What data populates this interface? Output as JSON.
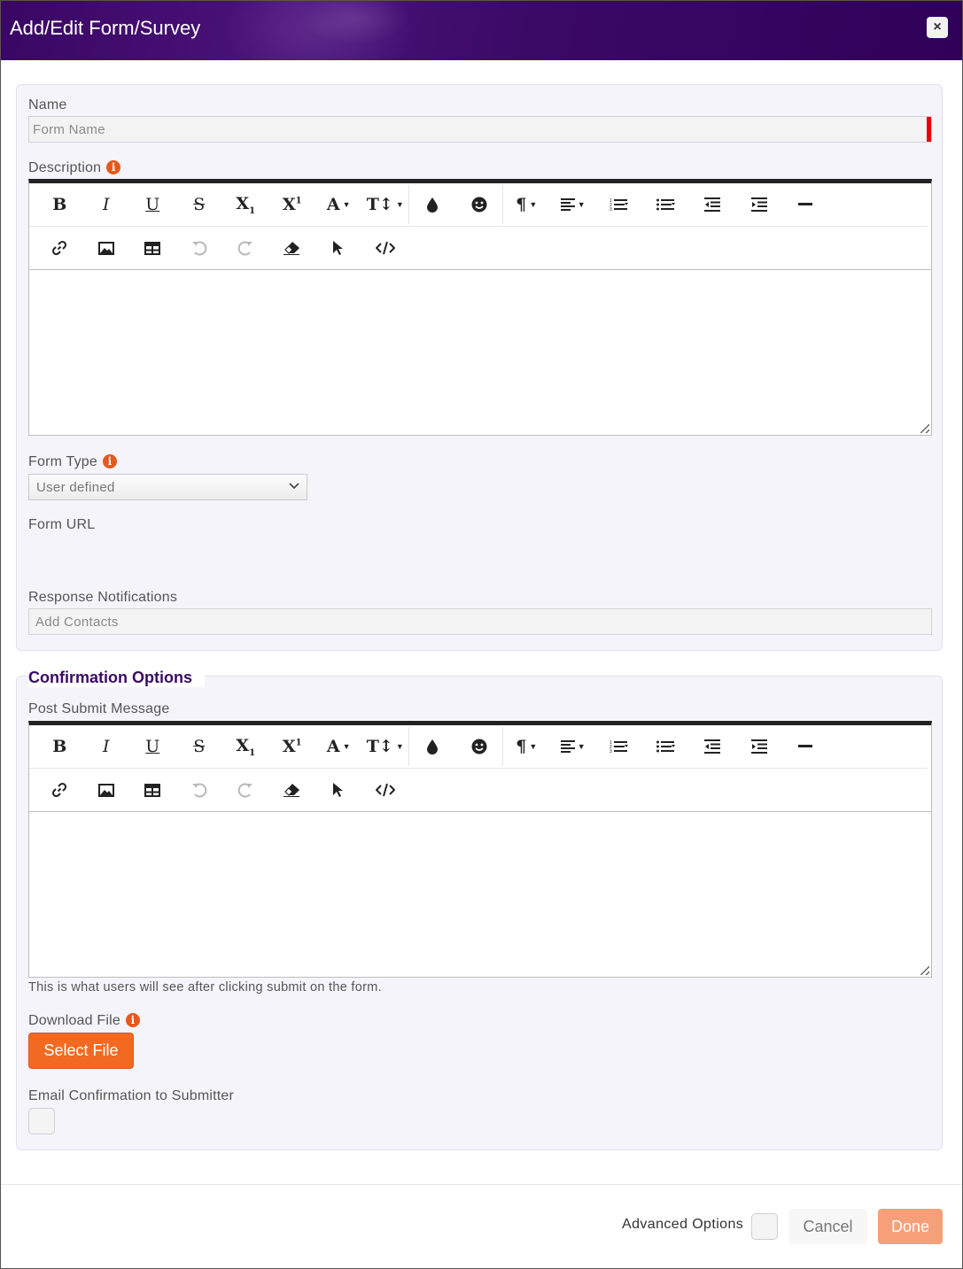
{
  "dialog": {
    "title": "Add/Edit Form/Survey",
    "close_label": "×"
  },
  "general": {
    "name_label": "Name",
    "name_placeholder": "Form Name",
    "description_label": "Description",
    "form_type_label": "Form Type",
    "form_type_value": "User defined",
    "form_url_label": "Form URL",
    "response_notifications_label": "Response Notifications",
    "contacts_placeholder": "Add Contacts"
  },
  "info_icon_glyph": "i",
  "editor_toolbar": {
    "row1": [
      "bold-icon",
      "italic-icon",
      "underline-icon",
      "strikethrough-icon",
      "subscript-icon",
      "superscript-icon",
      "font-color-icon",
      "font-size-icon",
      "|",
      "color-drop-icon",
      "emoji-icon",
      "|",
      "paragraph-format-icon",
      "align-icon",
      "ordered-list-icon",
      "unordered-list-icon",
      "outdent-icon",
      "indent-icon",
      "horizontal-line-icon"
    ],
    "row2": [
      "link-icon",
      "image-icon",
      "table-icon",
      "undo-icon",
      "redo-icon",
      "clear-format-icon",
      "select-all-icon",
      "code-view-icon"
    ]
  },
  "confirmation": {
    "section_title": "Confirmation Options",
    "post_submit_label": "Post Submit Message",
    "post_submit_hint": "This is what users will see after clicking submit on the form.",
    "download_file_label": "Download File",
    "select_file_button": "Select File",
    "email_confirmation_label": "Email Confirmation to Submitter"
  },
  "footer": {
    "advanced_options_label": "Advanced Options",
    "cancel_label": "Cancel",
    "done_label": "Done"
  },
  "colors": {
    "header": "#3a0663",
    "accent_orange": "#f26a21",
    "done_button": "#f6a079",
    "required_marker": "#e8000b",
    "section_title": "#3a0a63"
  }
}
